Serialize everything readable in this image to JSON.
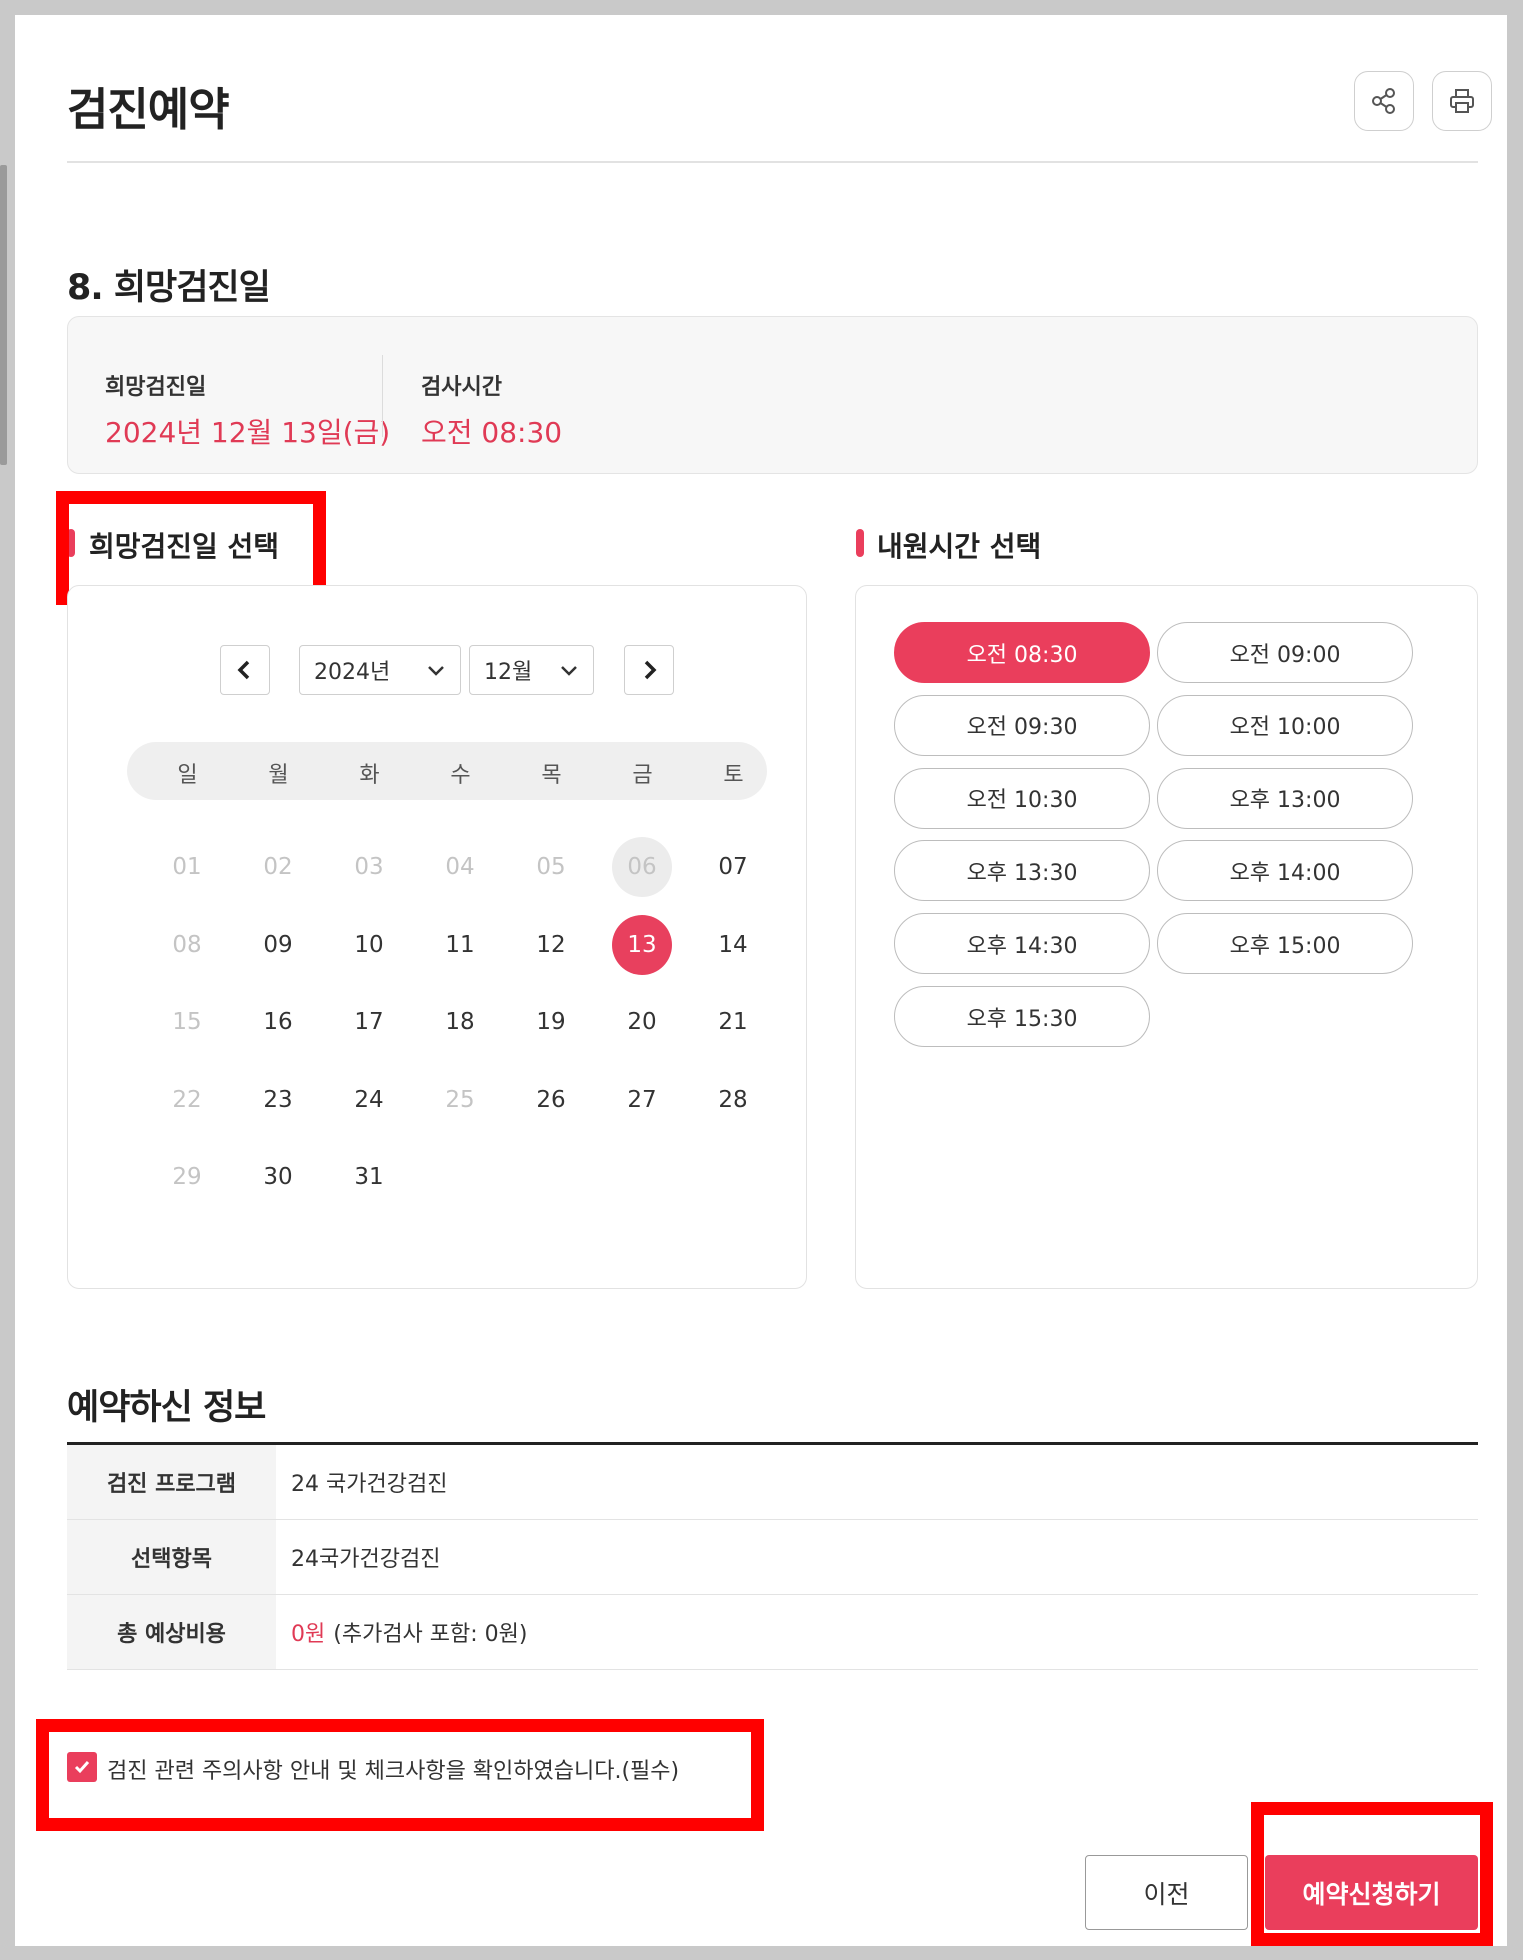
{
  "header": {
    "title": "검진예약",
    "share_icon": "share-icon",
    "print_icon": "print-icon"
  },
  "section": {
    "title": "8. 희망검진일"
  },
  "summary": {
    "date_label": "희망검진일",
    "date_value": "2024년 12월 13일(금)",
    "time_label": "검사시간",
    "time_value": "오전 08:30"
  },
  "calendar": {
    "title": "희망검진일 선택",
    "year_select": "2024년",
    "month_select": "12월",
    "weekdays": [
      "일",
      "월",
      "화",
      "수",
      "목",
      "금",
      "토"
    ],
    "weeks": [
      [
        {
          "d": "01",
          "s": "disabled"
        },
        {
          "d": "02",
          "s": "disabled"
        },
        {
          "d": "03",
          "s": "disabled"
        },
        {
          "d": "04",
          "s": "disabled"
        },
        {
          "d": "05",
          "s": "disabled"
        },
        {
          "d": "06",
          "s": "past-circle"
        },
        {
          "d": "07",
          "s": "normal"
        }
      ],
      [
        {
          "d": "08",
          "s": "disabled"
        },
        {
          "d": "09",
          "s": "normal"
        },
        {
          "d": "10",
          "s": "normal"
        },
        {
          "d": "11",
          "s": "normal"
        },
        {
          "d": "12",
          "s": "normal"
        },
        {
          "d": "13",
          "s": "selected"
        },
        {
          "d": "14",
          "s": "normal"
        }
      ],
      [
        {
          "d": "15",
          "s": "disabled"
        },
        {
          "d": "16",
          "s": "normal"
        },
        {
          "d": "17",
          "s": "normal"
        },
        {
          "d": "18",
          "s": "normal"
        },
        {
          "d": "19",
          "s": "normal"
        },
        {
          "d": "20",
          "s": "normal"
        },
        {
          "d": "21",
          "s": "normal"
        }
      ],
      [
        {
          "d": "22",
          "s": "disabled"
        },
        {
          "d": "23",
          "s": "normal"
        },
        {
          "d": "24",
          "s": "normal"
        },
        {
          "d": "25",
          "s": "disabled"
        },
        {
          "d": "26",
          "s": "normal"
        },
        {
          "d": "27",
          "s": "normal"
        },
        {
          "d": "28",
          "s": "normal"
        }
      ],
      [
        {
          "d": "29",
          "s": "disabled"
        },
        {
          "d": "30",
          "s": "normal"
        },
        {
          "d": "31",
          "s": "normal"
        }
      ]
    ]
  },
  "time": {
    "title": "내원시간 선택",
    "slots": [
      "오전 08:30",
      "오전 09:00",
      "오전 09:30",
      "오전 10:00",
      "오전 10:30",
      "오후 13:00",
      "오후 13:30",
      "오후 14:00",
      "오후 14:30",
      "오후 15:00",
      "오후 15:30"
    ],
    "selected": "오전 08:30"
  },
  "info": {
    "title": "예약하신 정보",
    "rows": [
      {
        "label": "검진 프로그램",
        "value": "24 국가건강검진"
      },
      {
        "label": "선택항목",
        "value": "24국가건강검진"
      },
      {
        "label": "총 예상비용",
        "value": "0원",
        "extra": "(추가검사 포함: 0원)"
      }
    ]
  },
  "agreement": {
    "text": "검진 관련 주의사항 안내 및 체크사항을 확인하였습니다.(필수)",
    "checked": true
  },
  "buttons": {
    "prev": "이전",
    "submit": "예약신청하기"
  },
  "colors": {
    "accent": "#ea3e5c",
    "highlight": "#ff0000"
  }
}
